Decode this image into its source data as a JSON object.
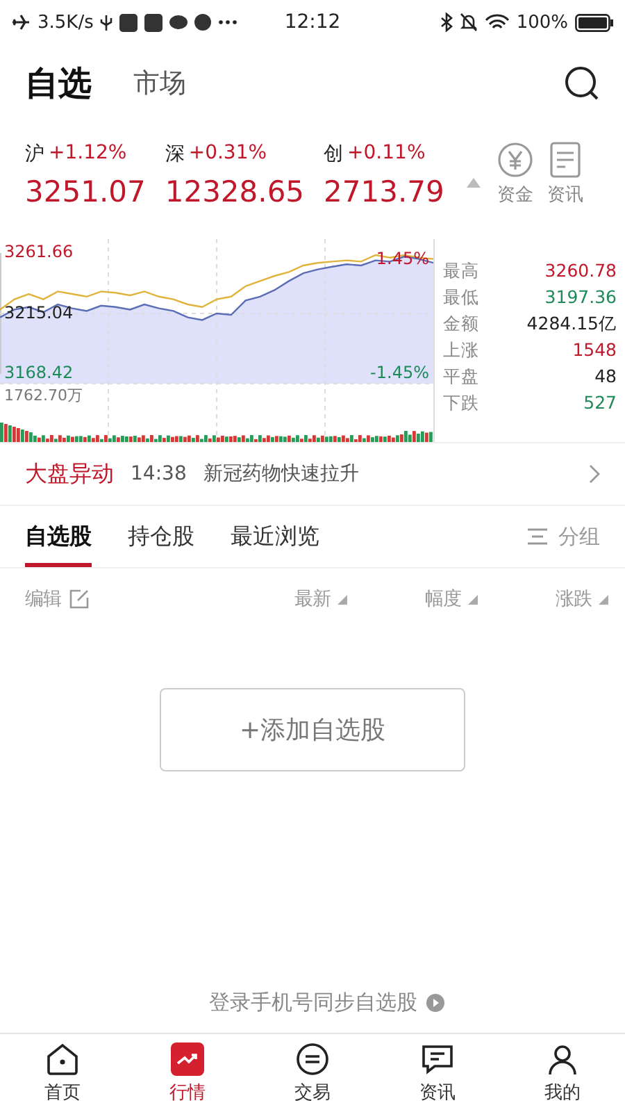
{
  "status_bar": {
    "speed": "3.5K/s",
    "time": "12:12",
    "battery": "100%"
  },
  "header_tabs": [
    {
      "label": "自选",
      "selected": true
    },
    {
      "label": "市场",
      "selected": false
    }
  ],
  "indices": [
    {
      "name": "沪",
      "change": "+1.12%",
      "value": "3251.07",
      "color": "#c0182b"
    },
    {
      "name": "深",
      "change": "+0.31%",
      "value": "12328.65",
      "color": "#c0182b"
    },
    {
      "name": "创",
      "change": "+0.11%",
      "value": "2713.79",
      "color": "#c0182b"
    }
  ],
  "shortcuts": [
    {
      "label": "资金",
      "kind": "yuan"
    },
    {
      "label": "资讯",
      "kind": "doc"
    }
  ],
  "chart": {
    "up_pct": "1.45%",
    "down_pct": "-1.45%",
    "volume_label": "1762.70万",
    "chart_data": {
      "type": "line",
      "ylim": [
        3168.42,
        3261.66
      ],
      "yticks": [
        {
          "value": 3261.66,
          "label": "3261.66"
        },
        {
          "value": 3215.04,
          "label": "3215.04"
        },
        {
          "value": 3168.42,
          "label": "3168.42"
        }
      ],
      "series": [
        {
          "color": "#5a6db5",
          "values": [
            3212,
            3218,
            3220,
            3216,
            3222,
            3219,
            3217,
            3221,
            3220,
            3218,
            3222,
            3219,
            3217,
            3212,
            3210,
            3215,
            3214,
            3225,
            3228,
            3233,
            3240,
            3246,
            3249,
            3251,
            3253,
            3252,
            3256,
            3255,
            3259,
            3257,
            3254
          ]
        },
        {
          "color": "#e0b43c",
          "values": [
            3218,
            3226,
            3230,
            3226,
            3232,
            3230,
            3228,
            3232,
            3231,
            3229,
            3232,
            3228,
            3226,
            3222,
            3220,
            3226,
            3228,
            3236,
            3240,
            3244,
            3247,
            3252,
            3254,
            3255,
            3256,
            3255,
            3260,
            3258,
            3260,
            3258,
            3257
          ]
        }
      ]
    }
  },
  "stats": [
    {
      "label": "最高",
      "value": "3260.78",
      "color": "#c0182b"
    },
    {
      "label": "最低",
      "value": "3197.36",
      "color": "#1e8a5a"
    },
    {
      "label": "金额",
      "value": "4284.15亿",
      "color": "#222222"
    },
    {
      "label": "上涨",
      "value": "1548",
      "color": "#c0182b"
    },
    {
      "label": "平盘",
      "value": "48",
      "color": "#222222"
    },
    {
      "label": "下跌",
      "value": "527",
      "color": "#1e8a5a"
    }
  ],
  "alert": {
    "tag": "大盘异动",
    "time": "14:38",
    "text": "新冠药物快速拉升"
  },
  "list_tabs": [
    {
      "label": "自选股",
      "selected": true
    },
    {
      "label": "持仓股",
      "selected": false
    },
    {
      "label": "最近浏览",
      "selected": false
    }
  ],
  "group_button": "分组",
  "columns": {
    "edit": "编辑",
    "sorts": [
      "最新",
      "幅度",
      "涨跌"
    ]
  },
  "add_button": "+添加自选股",
  "login_hint": "登录手机号同步自选股",
  "nav": [
    {
      "label": "首页",
      "kind": "home",
      "selected": false
    },
    {
      "label": "行情",
      "kind": "market",
      "selected": true
    },
    {
      "label": "交易",
      "kind": "trade",
      "selected": false
    },
    {
      "label": "资讯",
      "kind": "news",
      "selected": false
    },
    {
      "label": "我的",
      "kind": "me",
      "selected": false
    }
  ]
}
